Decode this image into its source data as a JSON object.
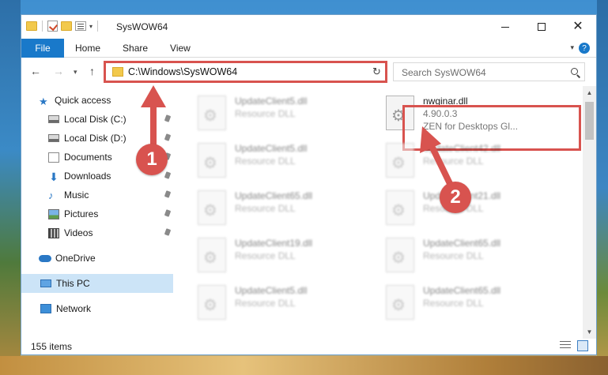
{
  "window": {
    "title": "SysWOW64"
  },
  "ribbon": {
    "tabs": [
      "File",
      "Home",
      "Share",
      "View"
    ]
  },
  "address_bar": {
    "path": "C:\\Windows\\SysWOW64"
  },
  "search": {
    "placeholder": "Search SysWOW64"
  },
  "sidebar": {
    "items": [
      {
        "label": "Quick access",
        "icon": "star-icon"
      },
      {
        "label": "Local Disk (C:)",
        "icon": "disk-icon",
        "pinned": true
      },
      {
        "label": "Local Disk (D:)",
        "icon": "disk-icon",
        "pinned": true
      },
      {
        "label": "Documents",
        "icon": "documents-icon",
        "pinned": true
      },
      {
        "label": "Downloads",
        "icon": "download-icon",
        "pinned": true
      },
      {
        "label": "Music",
        "icon": "music-icon",
        "pinned": true
      },
      {
        "label": "Pictures",
        "icon": "pictures-icon",
        "pinned": true
      },
      {
        "label": "Videos",
        "icon": "videos-icon",
        "pinned": true
      },
      {
        "label": "OneDrive",
        "icon": "cloud-icon"
      },
      {
        "label": "This PC",
        "icon": "computer-icon",
        "selected": true
      },
      {
        "label": "Network",
        "icon": "network-icon"
      }
    ]
  },
  "files": {
    "left_column": [
      {
        "name": "UpdateClient5.dll",
        "type": "Resource DLL"
      },
      {
        "name": "UpdateClient5.dll",
        "type": "Resource DLL"
      },
      {
        "name": "UpdateClient65.dll",
        "type": "Resource DLL"
      },
      {
        "name": "UpdateClient19.dll",
        "type": "Resource DLL"
      },
      {
        "name": "UpdateClient5.dll",
        "type": "Resource DLL"
      }
    ],
    "right_column": [
      {
        "name": "nwginar.dll",
        "version": "4.90.0.3",
        "type": "ZEN for Desktops Gl..."
      },
      {
        "name": "UpdateClient42.dll",
        "type": "Resource DLL"
      },
      {
        "name": "UpdateClient21.dll",
        "type": "Resource DLL"
      },
      {
        "name": "UpdateClient65.dll",
        "type": "Resource DLL"
      },
      {
        "name": "UpdateClient65.dll",
        "type": "Resource DLL"
      }
    ]
  },
  "status": {
    "item_count": "155 items"
  },
  "annotations": {
    "badge_1": "1",
    "badge_2": "2",
    "color": "#d8534f"
  }
}
